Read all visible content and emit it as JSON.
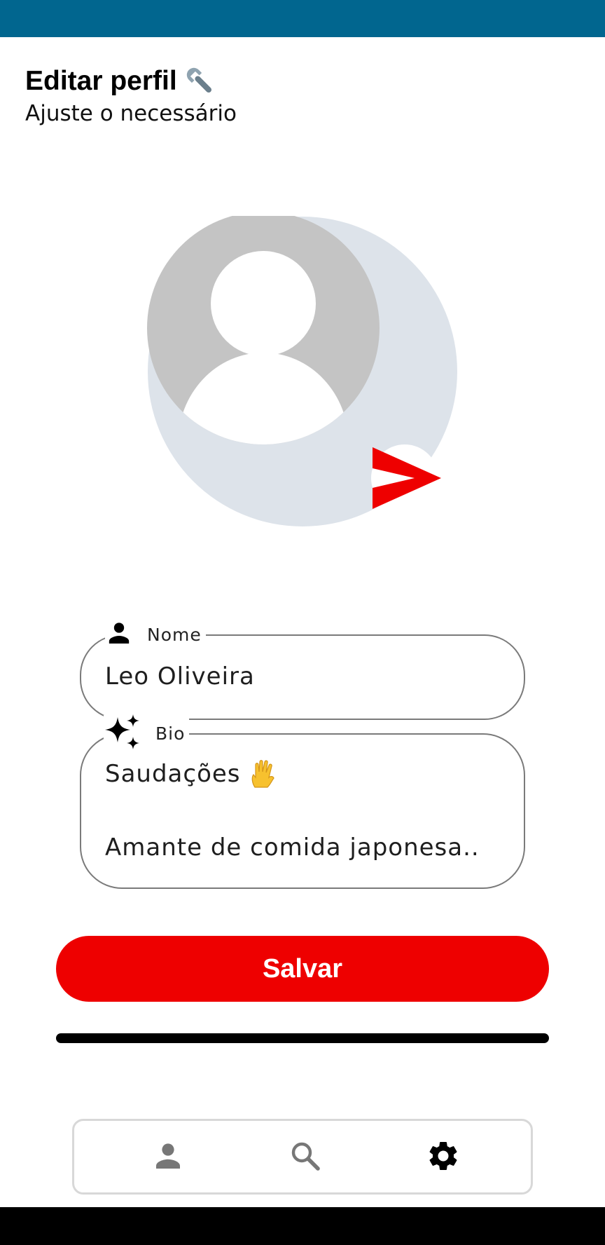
{
  "header": {
    "title": "Editar perfil",
    "subtitle": "Ajuste o necessário",
    "title_icon": "wrench-icon"
  },
  "avatar": {
    "icon": "person-placeholder-icon",
    "edit_icon": "send-arrow-icon"
  },
  "form": {
    "name": {
      "label": "Nome",
      "icon": "person-icon",
      "value": "Leo Oliveira"
    },
    "bio": {
      "label": "Bio",
      "icon": "sparkles-icon",
      "line1": "Saudações",
      "line1_emoji": "vulcan-salute-icon",
      "line2": "Amante de comida japonesa.."
    }
  },
  "actions": {
    "save_label": "Salvar"
  },
  "progress": {
    "fraction": 1.0
  },
  "bottom_nav": {
    "items": [
      {
        "icon": "person-icon",
        "active": false
      },
      {
        "icon": "search-icon",
        "active": false
      },
      {
        "icon": "gear-icon",
        "active": true
      }
    ]
  },
  "colors": {
    "status_bar": "#01668f",
    "accent": "#ee0000",
    "field_border": "#7a7a7a",
    "avatar_bg": "#dde3ea",
    "avatar_head_bg": "#c4c4c4",
    "nav_inactive": "#777777",
    "nav_active": "#000000"
  }
}
